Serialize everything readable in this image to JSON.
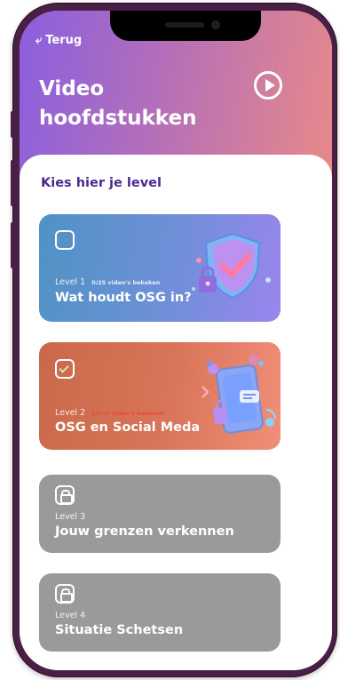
{
  "nav": {
    "back_label": "Terug"
  },
  "header": {
    "title_line1": "Video",
    "title_line2": "hoofdstukken"
  },
  "section": {
    "subtitle": "Kies hier je level"
  },
  "levels": [
    {
      "level": "Level 1",
      "count": "0/25 video's bekeken",
      "name": "Wat houdt OSG in?",
      "state": "unchecked",
      "count_color": "#e6ecff",
      "illustration": "shield-lock-illustration"
    },
    {
      "level": "Level 2",
      "count": "10/15 video's bekeken",
      "name": "OSG en Social Meda",
      "state": "checked",
      "count_color": "#e64b3c",
      "illustration": "phone-social-illustration"
    },
    {
      "level": "Level 3",
      "name": "Jouw grenzen verkennen",
      "state": "locked"
    },
    {
      "level": "Level 4",
      "name": "Situatie Schetsen",
      "state": "locked"
    }
  ],
  "colors": {
    "header_gradient_start": "#8a5fe0",
    "header_gradient_end": "#e98a88",
    "subtitle": "#4b2a8f",
    "card1": "#5f90cc",
    "card2": "#d66e52",
    "locked": "#9b9a9a"
  }
}
